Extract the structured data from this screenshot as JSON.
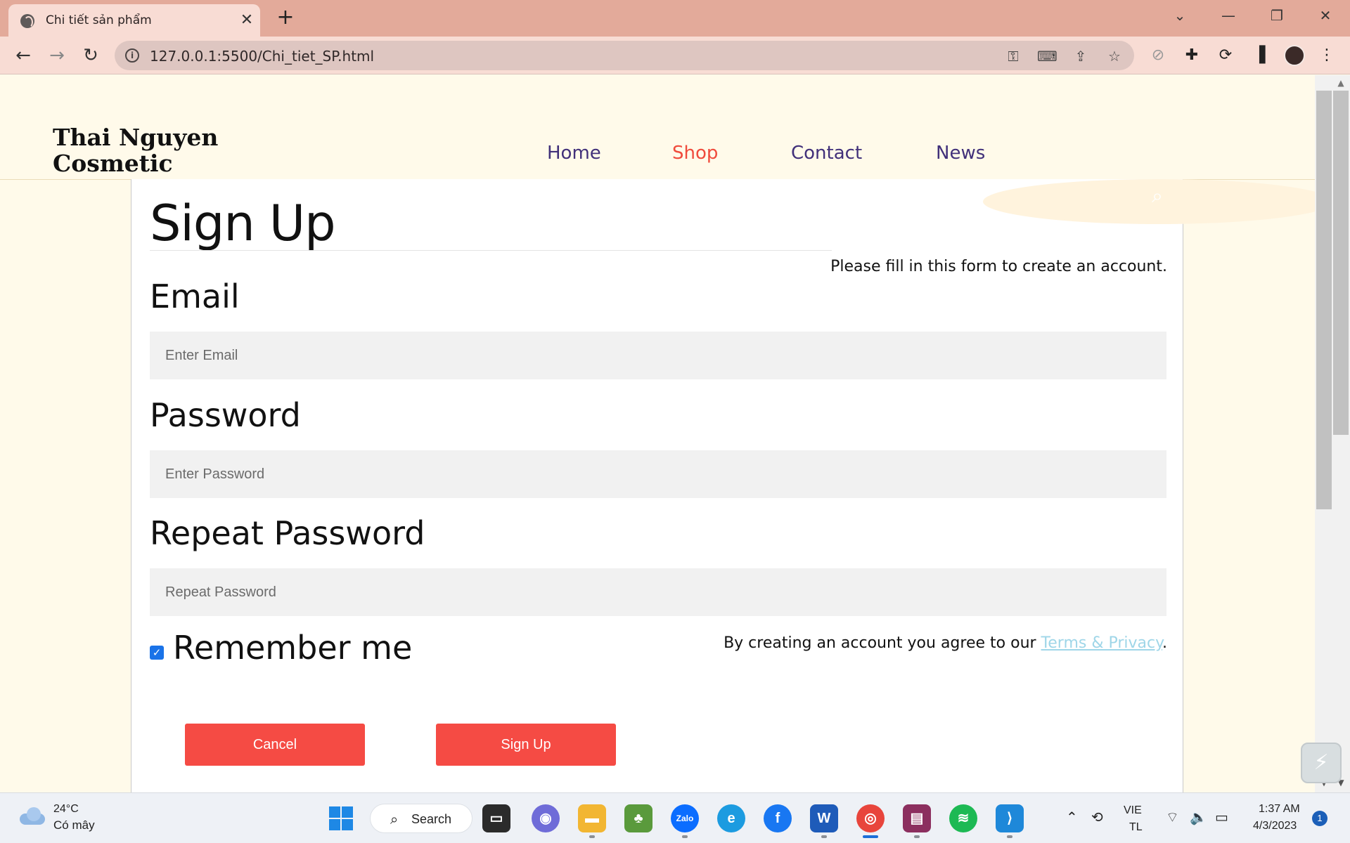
{
  "browser": {
    "tab_title": "Chi tiết sản phẩm",
    "tab_close": "✕",
    "new_tab": "+",
    "url": "127.0.0.1:5500/Chi_tiet_SP.html",
    "window_controls": {
      "chevron": "⌄",
      "minimize": "—",
      "restore": "❐",
      "close": "✕"
    }
  },
  "site": {
    "brand_line1": "Thai Nguyen",
    "brand_line2": "Cosmetic",
    "nav": [
      {
        "label": "Home",
        "active": false
      },
      {
        "label": "Shop",
        "active": true
      },
      {
        "label": "Contact",
        "active": false
      },
      {
        "label": "News",
        "active": false
      }
    ]
  },
  "form": {
    "title": "Sign Up",
    "subtitle": "Please fill in this form to create an account.",
    "email_label": "Email",
    "email_placeholder": "Enter Email",
    "password_label": "Password",
    "password_placeholder": "Enter Password",
    "repeat_label": "Repeat Password",
    "repeat_placeholder": "Repeat Password",
    "remember_label": "Remember me",
    "remember_checked": true,
    "terms_prefix": "By creating an account you agree to our ",
    "terms_link": "Terms & Privacy",
    "terms_suffix": ".",
    "cancel_label": "Cancel",
    "signup_label": "Sign Up"
  },
  "taskbar": {
    "temperature": "24°C",
    "condition": "Có mây",
    "search_label": "Search",
    "language_line1": "VIE",
    "language_line2": "TL",
    "time": "1:37 AM",
    "date": "4/3/2023",
    "notification_count": "1",
    "zalo_label": "Zalo"
  },
  "colors": {
    "accent_red": "#f54b44",
    "nav_text": "#41307a",
    "nav_active": "#f04b3c",
    "page_bg": "#fffaea",
    "link": "#9fd6e8"
  }
}
